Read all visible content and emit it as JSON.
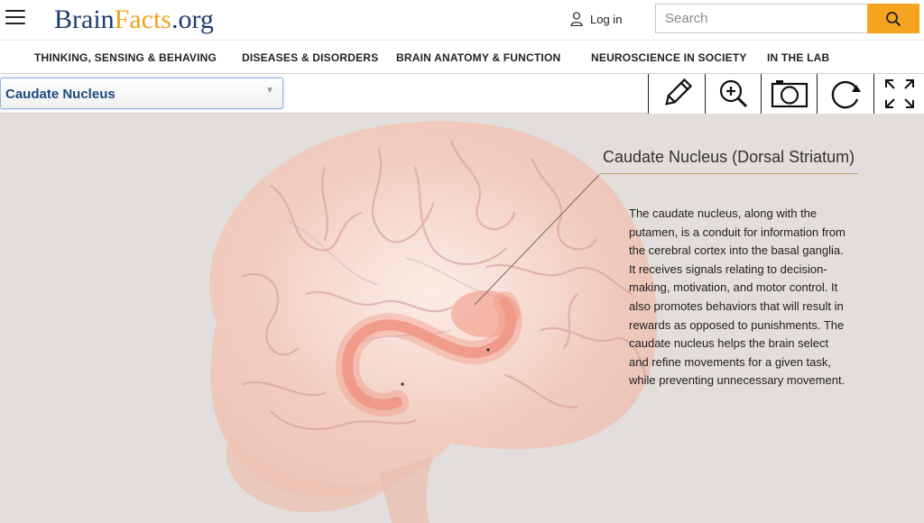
{
  "header": {
    "logo": {
      "brain": "Brain",
      "facts": "Facts",
      "tld": ".org"
    },
    "login_label": "Log in",
    "search": {
      "placeholder": "Search",
      "value": ""
    },
    "icons": {
      "menu": "hamburger-menu-icon",
      "user": "user-icon",
      "search": "search-icon"
    },
    "colors": {
      "brand_blue": "#1b3d6d",
      "brand_orange": "#f0a31c",
      "search_button": "#f4a41f"
    }
  },
  "nav": {
    "items": [
      {
        "label": "THINKING, SENSING & BEHAVING"
      },
      {
        "label": "DISEASES & DISORDERS"
      },
      {
        "label": "BRAIN ANATOMY & FUNCTION"
      },
      {
        "label": "NEUROSCIENCE IN SOCIETY"
      },
      {
        "label": "IN THE LAB"
      }
    ]
  },
  "toolbar": {
    "structure_select": {
      "selected": "Caudate Nucleus"
    },
    "tools": [
      {
        "icon": "pencil-icon"
      },
      {
        "icon": "zoom-in-icon"
      },
      {
        "icon": "camera-icon"
      },
      {
        "icon": "rotate-icon"
      },
      {
        "icon": "fullscreen-icon"
      }
    ]
  },
  "viewer": {
    "structure_title": "Caudate Nucleus (Dorsal Striatum)",
    "description": "The caudate nucleus, along with the putamen, is a conduit for information from the cerebral cortex into the basal ganglia. It receives signals relating to decision-making, motivation, and motor control. It also promotes behaviors that will result in rewards as opposed to punishments. The caudate nucleus helps the brain select and refine movements for a given task, while preventing unnecessary movement.",
    "background_color": "#e1dedb",
    "highlight_color": "#f08a78"
  }
}
